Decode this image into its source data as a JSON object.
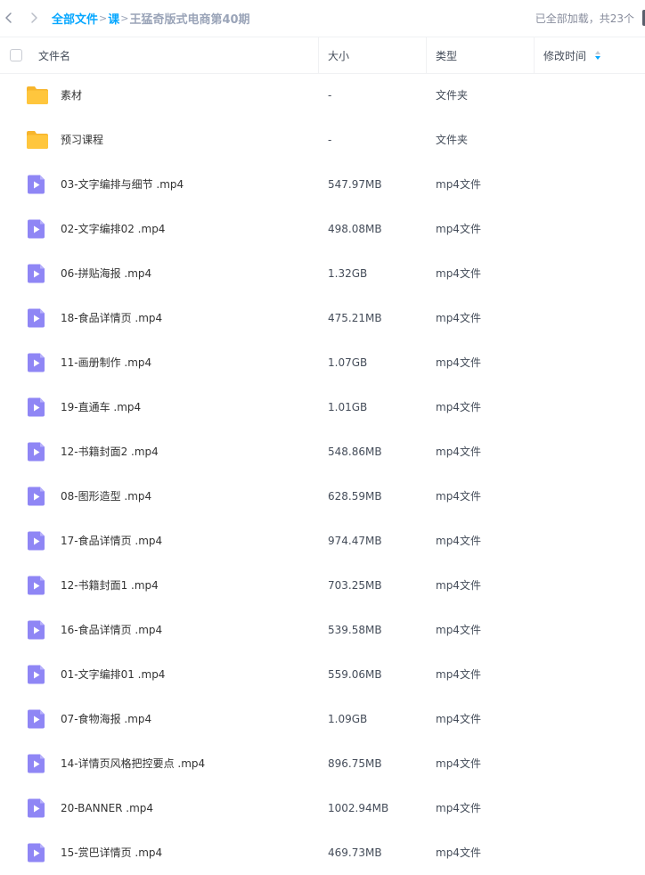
{
  "breadcrumb": {
    "root": "全部文件",
    "level1": "课",
    "current": "王猛奇版式电商第40期"
  },
  "status_text": "已全部加载，共23个",
  "columns": {
    "name": "文件名",
    "size": "大小",
    "type": "类型",
    "modified": "修改时间"
  },
  "colors": {
    "accent": "#06a7ff",
    "folder": "#ffc63d",
    "video_icon": "#8f86f5"
  },
  "files": [
    {
      "icon": "folder-icon",
      "name": "素材",
      "size": "-",
      "type": "文件夹",
      "modified": ""
    },
    {
      "icon": "folder-icon",
      "name": "预习课程",
      "size": "-",
      "type": "文件夹",
      "modified": ""
    },
    {
      "icon": "video-file-icon",
      "name": "03-文字编排与细节 .mp4",
      "size": "547.97MB",
      "type": "mp4文件",
      "modified": ""
    },
    {
      "icon": "video-file-icon",
      "name": "02-文字编排02 .mp4",
      "size": "498.08MB",
      "type": "mp4文件",
      "modified": ""
    },
    {
      "icon": "video-file-icon",
      "name": "06-拼贴海报 .mp4",
      "size": "1.32GB",
      "type": "mp4文件",
      "modified": ""
    },
    {
      "icon": "video-file-icon",
      "name": "18-食品详情页 .mp4",
      "size": "475.21MB",
      "type": "mp4文件",
      "modified": ""
    },
    {
      "icon": "video-file-icon",
      "name": "11-画册制作 .mp4",
      "size": "1.07GB",
      "type": "mp4文件",
      "modified": ""
    },
    {
      "icon": "video-file-icon",
      "name": "19-直通车 .mp4",
      "size": "1.01GB",
      "type": "mp4文件",
      "modified": ""
    },
    {
      "icon": "video-file-icon",
      "name": "12-书籍封面2 .mp4",
      "size": "548.86MB",
      "type": "mp4文件",
      "modified": ""
    },
    {
      "icon": "video-file-icon",
      "name": "08-图形造型 .mp4",
      "size": "628.59MB",
      "type": "mp4文件",
      "modified": ""
    },
    {
      "icon": "video-file-icon",
      "name": "17-食品详情页 .mp4",
      "size": "974.47MB",
      "type": "mp4文件",
      "modified": ""
    },
    {
      "icon": "video-file-icon",
      "name": "12-书籍封面1 .mp4",
      "size": "703.25MB",
      "type": "mp4文件",
      "modified": ""
    },
    {
      "icon": "video-file-icon",
      "name": "16-食品详情页 .mp4",
      "size": "539.58MB",
      "type": "mp4文件",
      "modified": ""
    },
    {
      "icon": "video-file-icon",
      "name": "01-文字编排01 .mp4",
      "size": "559.06MB",
      "type": "mp4文件",
      "modified": ""
    },
    {
      "icon": "video-file-icon",
      "name": "07-食物海报 .mp4",
      "size": "1.09GB",
      "type": "mp4文件",
      "modified": ""
    },
    {
      "icon": "video-file-icon",
      "name": "14-详情页风格把控要点 .mp4",
      "size": "896.75MB",
      "type": "mp4文件",
      "modified": ""
    },
    {
      "icon": "video-file-icon",
      "name": "20-BANNER .mp4",
      "size": "1002.94MB",
      "type": "mp4文件",
      "modified": ""
    },
    {
      "icon": "video-file-icon",
      "name": "15-赏巴详情页 .mp4",
      "size": "469.73MB",
      "type": "mp4文件",
      "modified": ""
    }
  ]
}
